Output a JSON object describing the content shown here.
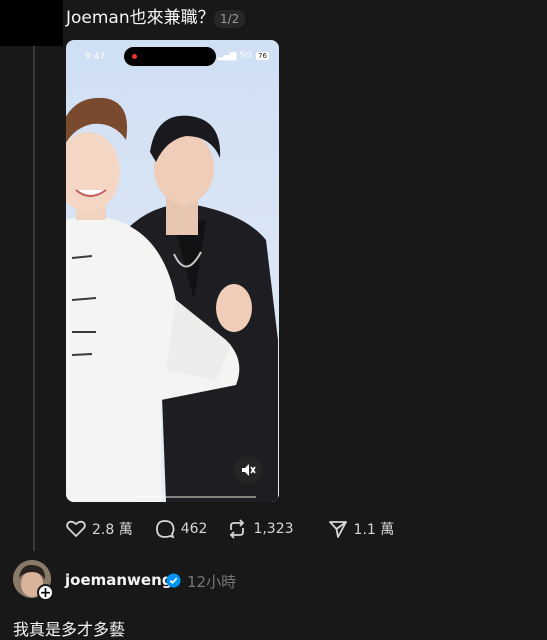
{
  "post": {
    "text": "Joeman也來兼職？",
    "page_indicator": "1/2"
  },
  "phone_status": {
    "time": "9:47",
    "network": "5G",
    "battery": "76"
  },
  "actions": {
    "likes": "2.8 萬",
    "comments": "462",
    "reposts": "1,323",
    "shares": "1.1 萬"
  },
  "reply": {
    "username": "joemanweng",
    "time": "12小時",
    "text": "我真是多才多藝"
  },
  "colors": {
    "background": "#181818",
    "text": "#f3f5f7",
    "muted": "#777777",
    "verified": "#0095f6"
  },
  "icons": [
    "heart-icon",
    "comment-icon",
    "repost-icon",
    "share-icon",
    "mute-icon",
    "verified-icon",
    "plus-icon"
  ]
}
